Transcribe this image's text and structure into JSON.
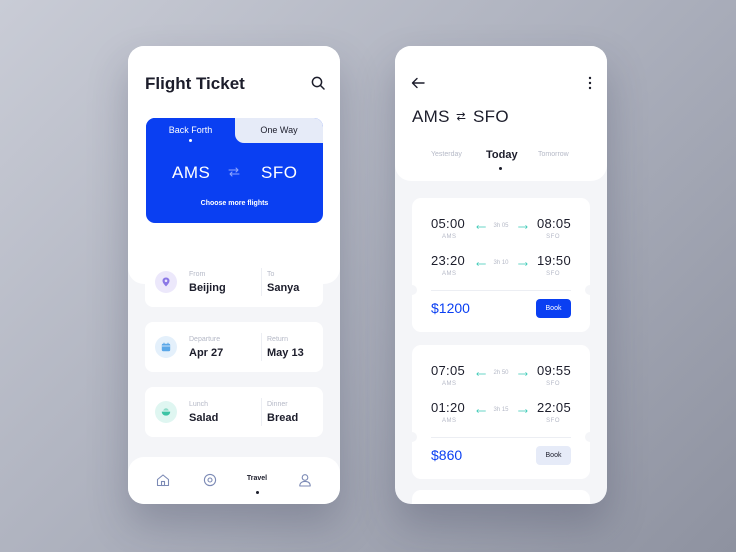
{
  "colors": {
    "accent": "#0a3ff2",
    "accent_soft": "#e6ebf8",
    "teal": "#37c9b5",
    "text_dark": "#1c1d2b",
    "text_muted": "#b5b9c7"
  },
  "search_screen": {
    "title": "Flight Ticket",
    "tabs": [
      {
        "label": "Back Forth",
        "selected": true
      },
      {
        "label": "One Way",
        "selected": false
      }
    ],
    "from_city": "AMS",
    "to_city": "SFO",
    "choose_more": "Choose more flights",
    "cards": [
      {
        "icon": "location-pin-icon",
        "left_label": "From",
        "left_value": "Beijing",
        "right_label": "To",
        "right_value": "Sanya"
      },
      {
        "icon": "calendar-icon",
        "left_label": "Departure",
        "left_value": "Apr 27",
        "right_label": "Return",
        "right_value": "May 13"
      },
      {
        "icon": "meal-icon",
        "left_label": "Lunch",
        "left_value": "Salad",
        "right_label": "Dinner",
        "right_value": "Bread"
      }
    ],
    "nav": [
      {
        "icon": "home-icon"
      },
      {
        "icon": "compass-icon"
      },
      {
        "label": "Travel",
        "selected": true
      },
      {
        "icon": "user-icon"
      }
    ]
  },
  "results_screen": {
    "route_from": "AMS",
    "route_to": "SFO",
    "day_tabs": [
      "Yesterday",
      "Today",
      "Tomorrow"
    ],
    "selected_day": "Today",
    "flights": [
      {
        "legs": [
          {
            "dep_time": "05:00",
            "dep_code": "AMS",
            "duration": "3h 05",
            "arr_time": "08:05",
            "arr_code": "SFO"
          },
          {
            "dep_time": "23:20",
            "dep_code": "AMS",
            "duration": "3h 10",
            "arr_time": "19:50",
            "arr_code": "SFO"
          }
        ],
        "price": "$1200",
        "book_label": "Book",
        "book_style": "primary"
      },
      {
        "legs": [
          {
            "dep_time": "07:05",
            "dep_code": "AMS",
            "duration": "2h 50",
            "arr_time": "09:55",
            "arr_code": "SFO"
          },
          {
            "dep_time": "01:20",
            "dep_code": "AMS",
            "duration": "3h 15",
            "arr_time": "22:05",
            "arr_code": "SFO"
          }
        ],
        "price": "$860",
        "book_label": "Book",
        "book_style": "secondary"
      }
    ]
  }
}
